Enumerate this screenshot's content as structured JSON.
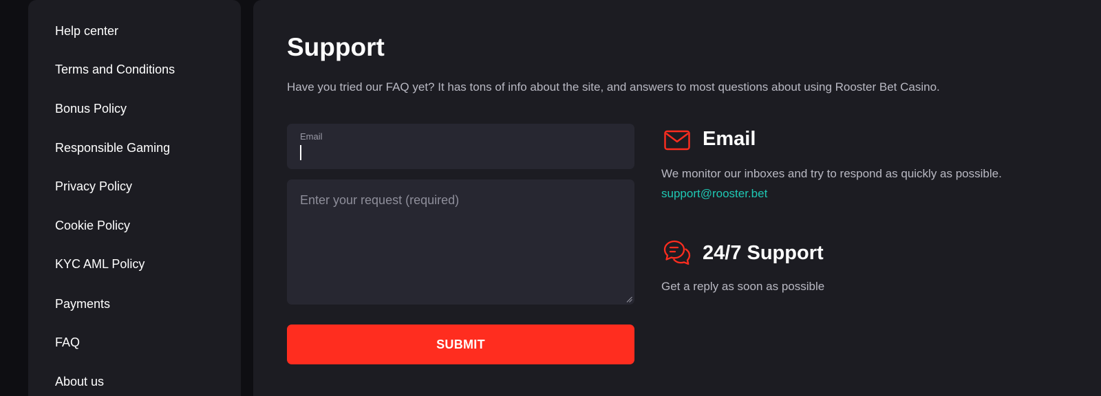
{
  "sidebar": {
    "items": [
      {
        "label": "Help center"
      },
      {
        "label": "Terms and Conditions"
      },
      {
        "label": "Bonus Policy"
      },
      {
        "label": "Responsible Gaming"
      },
      {
        "label": "Privacy Policy"
      },
      {
        "label": "Cookie Policy"
      },
      {
        "label": "KYC AML Policy"
      },
      {
        "label": "Payments"
      },
      {
        "label": "FAQ"
      },
      {
        "label": "About us"
      }
    ]
  },
  "main": {
    "title": "Support",
    "intro": "Have you tried our FAQ yet? It has tons of info about the site, and answers to most questions about using Rooster Bet Casino.",
    "form": {
      "email_label": "Email",
      "email_value": "",
      "request_placeholder": "Enter your request (required)",
      "submit_label": "SUBMIT"
    },
    "contacts": {
      "email": {
        "icon": "envelope-icon",
        "title": "Email",
        "text": "We monitor our inboxes and try to respond as quickly as possible.",
        "link": "support@rooster.bet"
      },
      "support": {
        "icon": "chat-bubbles-icon",
        "title": "24/7 Support",
        "text": "Get a reply as soon as possible"
      }
    }
  },
  "colors": {
    "accent": "#ff2d1f",
    "link": "#1fc8b4",
    "panel": "#1c1c22",
    "field": "#272731"
  }
}
